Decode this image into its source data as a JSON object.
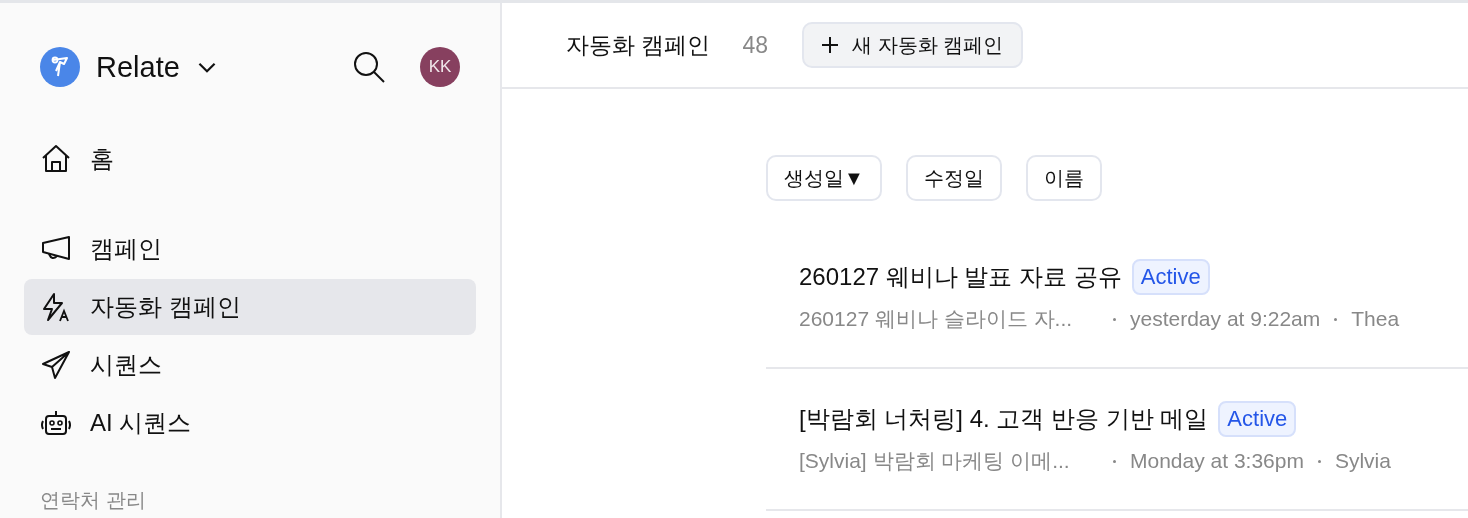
{
  "sidebar": {
    "workspace": "Relate",
    "avatar": "KK",
    "items": [
      {
        "label": "홈",
        "selected": false
      },
      {
        "label": "캠페인",
        "selected": false
      },
      {
        "label": "자동화 캠페인",
        "selected": true
      },
      {
        "label": "시퀀스",
        "selected": false
      },
      {
        "label": "AI 시퀀스",
        "selected": false
      }
    ],
    "section_label": "연락처 관리"
  },
  "header": {
    "title": "자동화 캠페인",
    "count": "48",
    "new_button": "새 자동화 캠페인"
  },
  "sort_buttons": [
    {
      "label": "생성일",
      "indicator": "▼"
    },
    {
      "label": "수정일"
    },
    {
      "label": "이름"
    }
  ],
  "campaigns": [
    {
      "title": "260127 웨비나 발표 자료 공유",
      "status": "Active",
      "subtitle": "260127 웨비나 슬라이드 자...",
      "time": "yesterday at 9:22am",
      "author": "Thea"
    },
    {
      "title": "[박람회 너처링] 4. 고객 반응 기반 메일",
      "status": "Active",
      "subtitle": "[Sylvia] 박람회 마케팅 이메...",
      "time": "Monday at 3:36pm",
      "author": "Sylvia"
    }
  ]
}
